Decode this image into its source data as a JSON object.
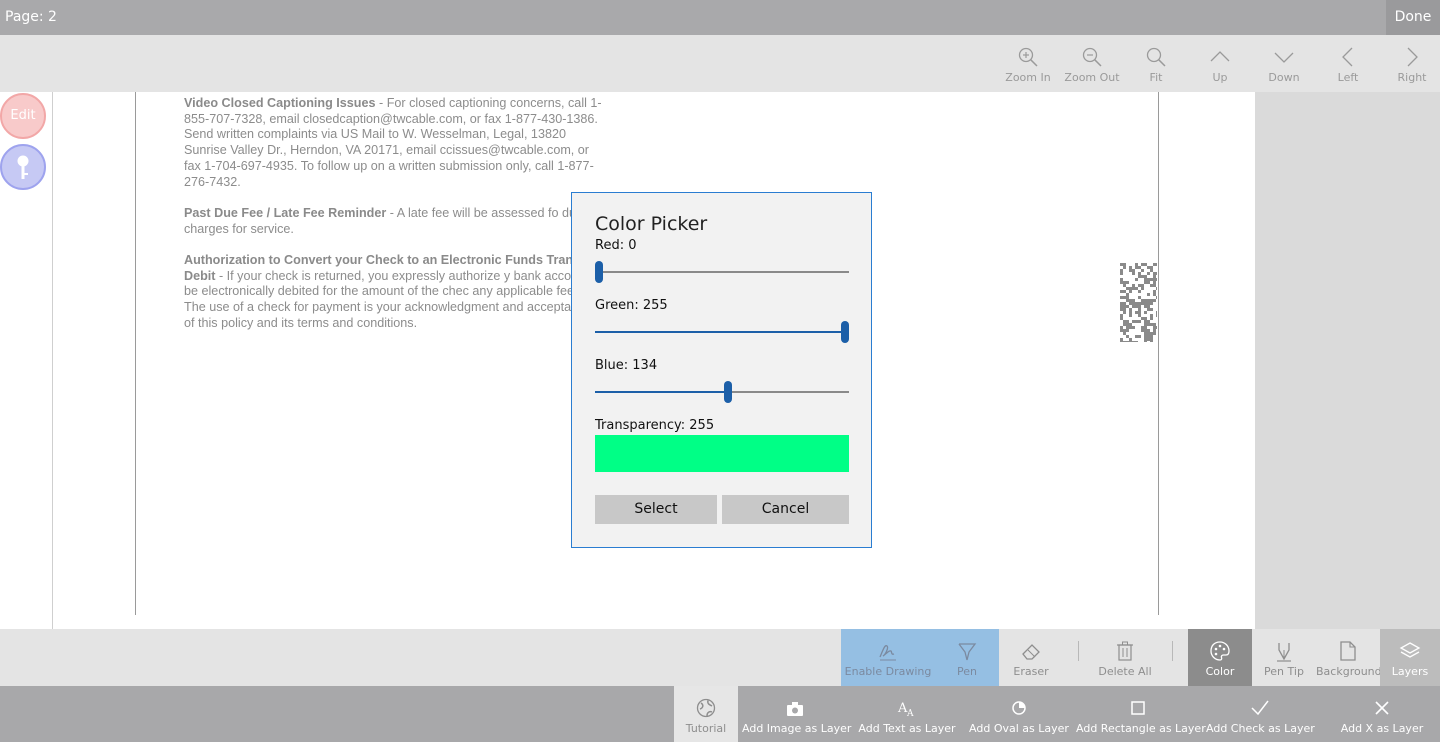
{
  "topbar": {
    "page_label": "Page: 2",
    "done_label": "Done"
  },
  "nav": {
    "buttons": [
      {
        "label": "Zoom In",
        "icon": "zoom-in-icon"
      },
      {
        "label": "Zoom Out",
        "icon": "zoom-out-icon"
      },
      {
        "label": "Fit",
        "icon": "search-icon"
      },
      {
        "label": "Up",
        "icon": "chevron-up-icon"
      },
      {
        "label": "Down",
        "icon": "chevron-down-icon"
      },
      {
        "label": "Left",
        "icon": "chevron-left-icon"
      },
      {
        "label": "Right",
        "icon": "chevron-right-icon"
      }
    ]
  },
  "side": {
    "edit_label": "Edit",
    "key_icon": "key-icon"
  },
  "document": {
    "paragraphs": [
      {
        "heading": "Video Closed Captioning Issues",
        "body": " - For closed captioning concerns, call 1-855-707-7328, email closedcaption@twcable.com, or fax 1-877-430-1386. Send written complaints via US Mail to W. Wesselman, Legal, 13820 Sunrise Valley Dr., Herndon, VA 20171, email ccissues@twcable.com, or fax 1-704-697-4935. To follow up on a written submission only, call 1-877-276-7432."
      },
      {
        "heading": "Past Due Fee / Late Fee Reminder",
        "body": " - A late fee will be assessed fo due charges for service."
      },
      {
        "heading": "Authorization to Convert your Check to an Electronic Funds Transfer Debit",
        "body": " - If your check is returned, you expressly authorize y bank account to be electronically debited for the amount of the chec any applicable fees. The use of a check for payment is your acknowledgment and acceptance of this policy and its terms and conditions."
      }
    ]
  },
  "dialog": {
    "title": "Color Picker",
    "red": {
      "label": "Red: 0",
      "value": 0,
      "max": 255
    },
    "green": {
      "label": "Green: 255",
      "value": 255,
      "max": 255
    },
    "blue": {
      "label": "Blue: 134",
      "value": 134,
      "max": 255
    },
    "transparency": {
      "label": "Transparency: 255",
      "value": 255,
      "max": 255
    },
    "preview_color": "#00ff86",
    "select_label": "Select",
    "cancel_label": "Cancel"
  },
  "drawing_toolbar": {
    "items": [
      {
        "label": "Enable Drawing",
        "icon": "signature-pen-icon",
        "state": "active"
      },
      {
        "label": "Pen",
        "icon": "pen-icon",
        "state": "active"
      },
      {
        "label": "Eraser",
        "icon": "eraser-icon",
        "state": "normal"
      },
      {
        "label": "Delete All",
        "icon": "trash-icon",
        "state": "normal"
      },
      {
        "label": "Color",
        "icon": "palette-icon",
        "state": "selected"
      },
      {
        "label": "Pen Tip",
        "icon": "pen-tip-icon",
        "state": "normal"
      },
      {
        "label": "Background",
        "icon": "page-icon",
        "state": "normal"
      },
      {
        "label": "Layers",
        "icon": "layers-icon",
        "state": "highlight"
      }
    ]
  },
  "bottom_toolbar": {
    "items": [
      {
        "label": "Tutorial",
        "icon": "globe-icon"
      },
      {
        "label": "Add Image as Layer",
        "icon": "camera-icon"
      },
      {
        "label": "Add Text as Layer",
        "icon": "text-icon"
      },
      {
        "label": "Add Oval as Layer",
        "icon": "oval-icon"
      },
      {
        "label": "Add Rectangle as Layer",
        "icon": "rectangle-icon"
      },
      {
        "label": "Add Check as Layer",
        "icon": "check-icon"
      },
      {
        "label": "Add X as Layer",
        "icon": "x-icon"
      }
    ]
  },
  "colors": {
    "accent": "#1c5fa8",
    "dialog_border": "#2a7dd1",
    "active_tool": "#95bfe3"
  }
}
